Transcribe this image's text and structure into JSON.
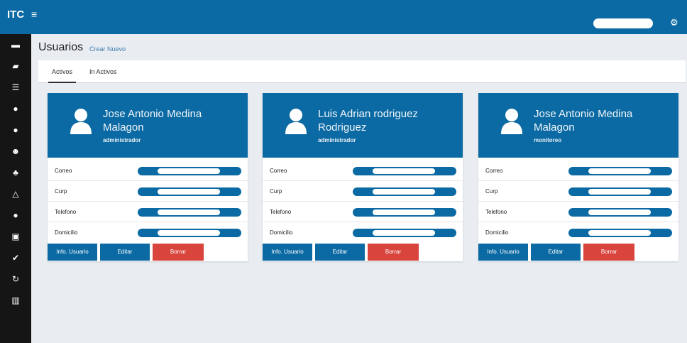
{
  "topbar": {
    "brand": "ITC",
    "menu_icon": "hamburger-icon",
    "settings_icon": "gears-icon",
    "accent": "#0b6aa3"
  },
  "sidebar": {
    "icons": [
      "folder-icon",
      "folder-icon",
      "list-icon",
      "user-icon",
      "user-icon",
      "users-icon",
      "sitemap-icon",
      "warning-icon",
      "map-marker-icon",
      "calendar-icon",
      "check-icon",
      "history-icon",
      "bar-chart-icon"
    ]
  },
  "page": {
    "title": "Usuarios",
    "subtitle": "Crear Nuevo"
  },
  "tabs": [
    {
      "label": "Activos",
      "active": true
    },
    {
      "label": "In Activos",
      "active": false
    }
  ],
  "field_labels": [
    "Correo",
    "Curp",
    "Telefono",
    "Domicilio"
  ],
  "buttons": {
    "info": "Info. Usuario",
    "edit": "Editar",
    "delete": "Borrar",
    "danger_color": "#d9453d"
  },
  "cards": [
    {
      "name": "Jose Antonio Medina Malagon",
      "role": "administrador"
    },
    {
      "name": "Luis Adrian rodriguez Rodriguez",
      "role": "administrador"
    },
    {
      "name": "Jose Antonio Medina Malagon",
      "role": "monitoreo"
    }
  ]
}
